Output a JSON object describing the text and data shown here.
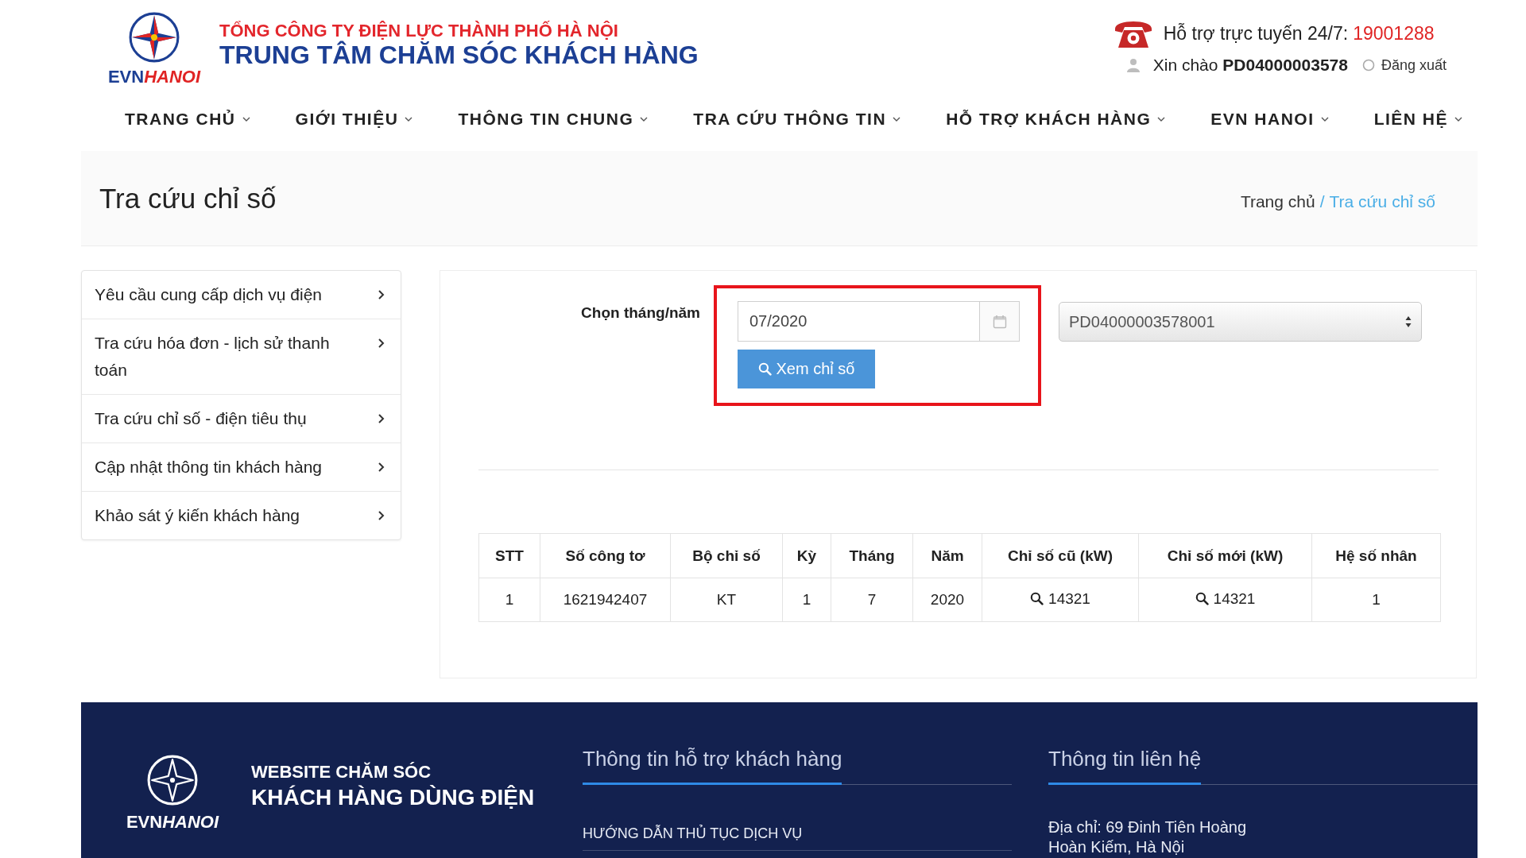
{
  "header": {
    "brand": {
      "lead": "EVN",
      "accent": "HANOI"
    },
    "company": "TỔNG CÔNG TY ĐIỆN LỰC THÀNH PHỐ HÀ NỘI",
    "site_title": "TRUNG TÂM CHĂM SÓC KHÁCH HÀNG",
    "hotline_label": "Hỗ trợ trực tuyến 24/7:",
    "hotline_number": "19001288",
    "greeting": "Xin chào **PD04000003578**",
    "logout": "Đăng xuất"
  },
  "nav": [
    {
      "label": "TRANG CHỦ"
    },
    {
      "label": "GIỚI THIỆU"
    },
    {
      "label": "THÔNG TIN CHUNG"
    },
    {
      "label": "TRA CỨU THÔNG TIN"
    },
    {
      "label": "HỖ TRỢ KHÁCH HÀNG"
    },
    {
      "label": "EVN HANOI"
    },
    {
      "label": "LIÊN HỆ"
    }
  ],
  "page_title": "Tra cứu chỉ số",
  "breadcrumb": {
    "separator": "/",
    "items": [
      {
        "label": "Trang chủ",
        "selected": false
      },
      {
        "label": "Tra cứu chỉ số",
        "selected": true
      }
    ]
  },
  "sidebar": {
    "items": [
      {
        "label": "Yêu cầu cung cấp dịch vụ điện"
      },
      {
        "label": "Tra cứu hóa đơn - lịch sử thanh toán"
      },
      {
        "label": "Tra cứu chỉ số - điện tiêu thụ"
      },
      {
        "label": "Cập nhật thông tin khách hàng"
      },
      {
        "label": "Khảo sát ý kiến khách hàng"
      }
    ]
  },
  "form": {
    "month_label": "Chọn tháng/năm",
    "highlighted": true,
    "month_field": {
      "value": "07/2020"
    },
    "submit_button": "Xem chỉ số",
    "meter_select": {
      "value": "PD04000003578001"
    }
  },
  "table": {
    "columns": [
      {
        "label": "STT",
        "kind": "text"
      },
      {
        "label": "Số công tơ",
        "kind": "text"
      },
      {
        "label": "Bộ chỉ số",
        "kind": "text"
      },
      {
        "label": "Kỳ",
        "kind": "text"
      },
      {
        "label": "Tháng",
        "kind": "text"
      },
      {
        "label": "Năm",
        "kind": "text"
      },
      {
        "label": "Chỉ số cũ (kW)",
        "kind": "lookup"
      },
      {
        "label": "Chỉ số mới (kW)",
        "kind": "lookup"
      },
      {
        "label": "Hệ số nhân",
        "kind": "text"
      }
    ],
    "rows": [
      {
        "cells": [
          "1",
          "1621942407",
          "KT",
          "1",
          "7",
          "2020",
          "14321",
          "14321",
          "1"
        ]
      }
    ]
  },
  "footer": {
    "brand": {
      "lead": "EVN",
      "accent": "HANOI"
    },
    "tagline": "WEBSITE CHĂM SÓC",
    "site_title": "KHÁCH HÀNG DÙNG ĐIỆN",
    "columns": [
      {
        "kind": "links",
        "title": "Thông tin hỗ trợ khách hàng",
        "lines": [
          "HƯỚNG DẪN THỦ TỤC DỊCH VỤ"
        ]
      },
      {
        "kind": "contact",
        "title": "Thông tin liên hệ",
        "lines": [
          "Địa chỉ: 69 Đinh Tiên Hoàng",
          "Hoàn Kiếm, Hà Nội"
        ]
      }
    ]
  }
}
